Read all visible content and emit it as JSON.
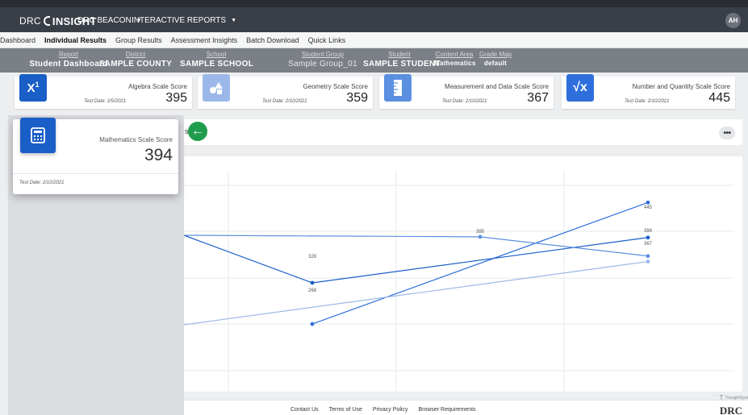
{
  "header": {
    "logo_left": "DRC",
    "logo_right": "INSIGHT",
    "menu1": "DRC BEACON",
    "menu2": "INTERACTIVE REPORTS",
    "user_initials": "AH"
  },
  "nav": {
    "tabs": [
      "Dashboard",
      "Individual Results",
      "Group Results",
      "Assessment Insights",
      "Batch Download",
      "Quick Links"
    ],
    "active": "Individual Results"
  },
  "filters": [
    {
      "label": "Report",
      "value": "Student Dashboard"
    },
    {
      "label": "District",
      "value": "SAMPLE COUNTY"
    },
    {
      "label": "School",
      "value": "SAMPLE SCHOOL"
    },
    {
      "label": "Student Group",
      "value": "Sample Group_01"
    },
    {
      "label": "Student",
      "value": "SAMPLE STUDENT"
    },
    {
      "label": "Content Area",
      "value": "Mathematics"
    },
    {
      "label": "Grade Map",
      "value": "default"
    }
  ],
  "cards": [
    {
      "title": "Algebra Scale Score",
      "date": "Test Date: 2/5/2021",
      "score": "395",
      "color": "#1a5ec8",
      "icon": "superscript-x-icon"
    },
    {
      "title": "Geometry Scale Score",
      "date": "Test Date: 2/10/2021",
      "score": "359",
      "color": "#9bb8e8",
      "icon": "shapes-icon"
    },
    {
      "title": "Measurement and Data Scale Score",
      "date": "Test Date: 2/10/2021",
      "score": "367",
      "color": "#5b8fe0",
      "icon": "ruler-icon"
    },
    {
      "title": "Number and Quantity Scale Score",
      "date": "Test Date: 2/10/2021",
      "score": "445",
      "color": "#2e6fdc",
      "icon": "square-root-icon"
    }
  ],
  "popup": {
    "title": "Mathematics Scale Score",
    "score": "394",
    "date": "Test Date: 2/10/2021",
    "icon": "calculator-icon"
  },
  "chart_header": {
    "partial_text": "s"
  },
  "chart_data": {
    "type": "line",
    "categories": [
      "",
      "",
      "",
      ""
    ],
    "series": [
      {
        "color": "#2e6fdc",
        "values": [
          null,
          268,
          null,
          445
        ]
      },
      {
        "color": "#1a5ec8",
        "values": [
          null,
          328,
          null,
          394
        ]
      },
      {
        "color": "#5b8fe0",
        "values": [
          null,
          null,
          395,
          367
        ]
      },
      {
        "color": "#9bb8e8",
        "values": [
          null,
          null,
          null,
          359
        ]
      }
    ],
    "data_labels": [
      "445",
      "394",
      "367",
      "395",
      "328",
      "268"
    ]
  },
  "footer": {
    "links": [
      "Contact Us",
      "Terms of Use",
      "Privacy Policy",
      "Browser Requirements"
    ],
    "brand": "DRC",
    "powered": "ThoughtSpot"
  }
}
